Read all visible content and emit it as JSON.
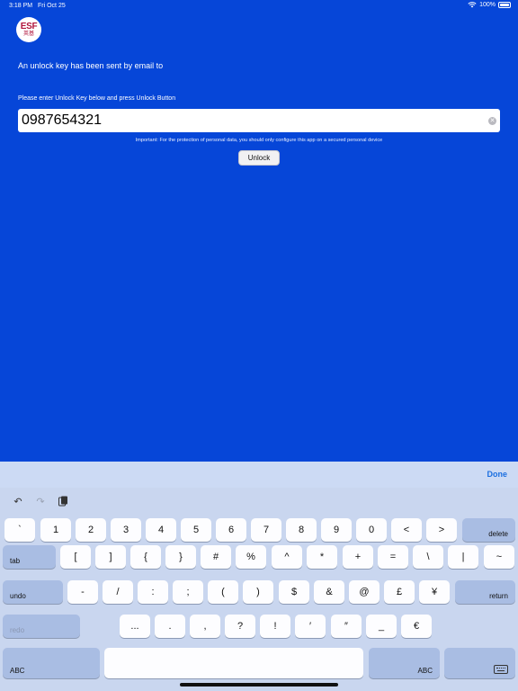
{
  "status_bar": {
    "time": "3:18 PM",
    "date": "Fri Oct 25",
    "battery": "100%"
  },
  "logo": {
    "main": "ESF",
    "sub": "英基"
  },
  "messages": {
    "unlock_sent": "An unlock key has been sent by email to",
    "enter_key": "Please enter Unlock Key below and press Unlock Button",
    "important": "Important: For the protection of personal data, you should only configure this app on a secured personal device"
  },
  "unlock_key_value": "0987654321",
  "unlock_button": "Unlock",
  "keyboard": {
    "done": "Done",
    "row1": [
      "`",
      "1",
      "2",
      "3",
      "4",
      "5",
      "6",
      "7",
      "8",
      "9",
      "0",
      "<",
      ">"
    ],
    "delete": "delete",
    "tab": "tab",
    "row2": [
      "[",
      "]",
      "{",
      "}",
      "#",
      "%",
      "^",
      "*",
      "+",
      "=",
      "\\",
      "|",
      "~"
    ],
    "undo": "undo",
    "row3": [
      "-",
      "/",
      ":",
      ";",
      "(",
      ")",
      "$",
      "&",
      "@",
      "£",
      "¥"
    ],
    "return": "return",
    "redo": "redo",
    "row4": [
      "...",
      ".",
      ",",
      "?",
      "!",
      "′",
      "″",
      "_",
      "€"
    ],
    "abc": "ABC"
  }
}
